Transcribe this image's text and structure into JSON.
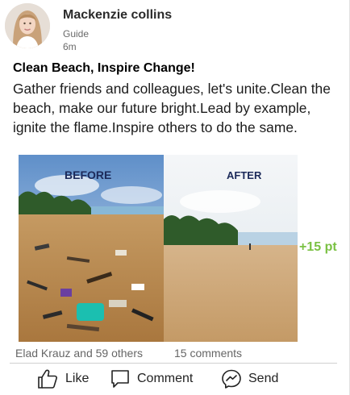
{
  "post": {
    "author": {
      "name": "Mackenzie collins",
      "role": "Guide",
      "time": "6m"
    },
    "title": "Clean Beach, Inspire Change!",
    "body": "Gather friends and colleagues, let's unite.Clean the beach, make our future bright.Lead by example, ignite the flame.Inspire others to do the same.",
    "image": {
      "before_label": "BEFORE",
      "after_label": "AFTER"
    },
    "points_badge": "+15 pt",
    "stats": {
      "reactions": "Elad Krauz and 59 others",
      "comments": "15 comments"
    },
    "actions": {
      "like": "Like",
      "comment": "Comment",
      "send": "Send"
    }
  },
  "colors": {
    "points_green": "#7ac143",
    "author_text": "#2a2a2a",
    "meta_text": "#6a6a6a"
  },
  "icons": [
    "thumbs-up-icon",
    "comment-bubble-icon",
    "messenger-icon"
  ]
}
